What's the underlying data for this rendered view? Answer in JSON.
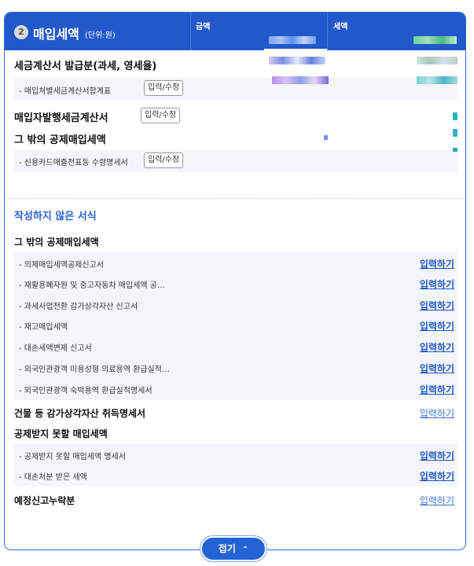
{
  "header": {
    "number": "2",
    "title": "매입세액",
    "unit": "(단위:원)",
    "col_amount": "금액",
    "col_tax": "세액"
  },
  "written": {
    "tax_invoice_label": "세금계산서 발급분(과세, 영세율)",
    "tax_invoice_sub_label": "- 매입처별세금계산서합계표",
    "buyer_issued_label": "매입자발행세금계산서",
    "other_deduction_label": "그 밖의 공제매입세액",
    "credit_card_sub_label": "- 신용카드매출전표등 수령명세서",
    "edit_button": "입력/수정"
  },
  "unwritten": {
    "title": "작성하지 않은 서식",
    "group_other": "그 밖의 공제매입세액",
    "items_other": [
      "- 의제매입세액공제신고서",
      "- 재활용폐자원 및 중고자동차 매입세액 공…",
      "- 과세사업전환 감가상각자산 신고서",
      "- 재고매입세액",
      "- 대손세액변제 신고서",
      "- 외국인관광객 미용성형 의료용역 환급실적…",
      "- 외국인관광객 숙박용역 환급실적명세서"
    ],
    "building_label": "건물 등 감가상각자산 취득명세서",
    "non_deductible_label": "공제받지 못할 매입세액",
    "items_non_deductible": [
      "- 공제받지 못할 매입세액 명세서",
      "- 대손처분 받은 세액"
    ],
    "omission_label": "예정신고누락분",
    "input_link": "입력하기"
  },
  "fold_button": "접기",
  "colors": {
    "header_bg": "#2258c9",
    "accent": "#2463d6",
    "sub_row_bg": "#f3f5f9"
  }
}
